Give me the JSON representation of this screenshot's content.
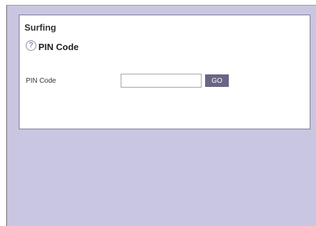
{
  "panel": {
    "title": "Surfing",
    "section": {
      "help_icon": "help-question-icon",
      "help_glyph": "?",
      "title": "PIN Code"
    },
    "form": {
      "pin_label": "PIN Code",
      "pin_value": "",
      "pin_placeholder": "",
      "go_label": "GO"
    }
  },
  "colors": {
    "frame_background": "#c9c6e1",
    "panel_border": "#7d7a96",
    "go_button": "#6a6584",
    "help_icon": "#8e8aa8"
  }
}
